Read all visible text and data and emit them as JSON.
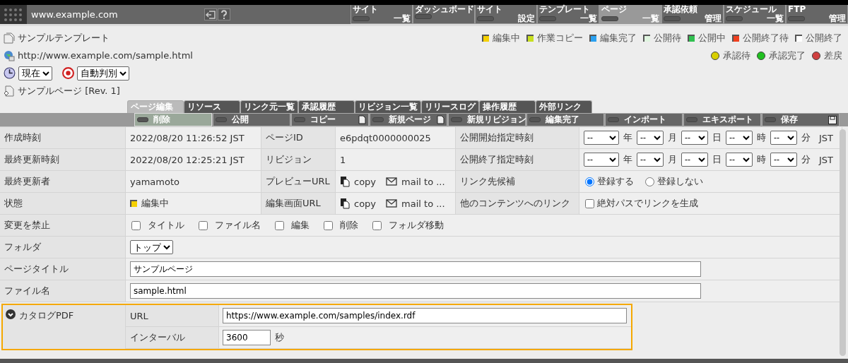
{
  "header": {
    "site": "www.example.com",
    "nav": [
      {
        "top": "サイト",
        "bottom": "一覧",
        "selected": false
      },
      {
        "top": "ダッシュボード",
        "selected": false
      },
      {
        "top": "サイト",
        "bottom": "設定",
        "selected": false
      },
      {
        "top": "テンプレート",
        "bottom": "一覧",
        "selected": false
      },
      {
        "top": "ページ",
        "bottom": "一覧",
        "selected": true
      },
      {
        "top": "承認依頼",
        "bottom": "管理",
        "selected": false
      },
      {
        "top": "スケジュール",
        "bottom": "一覧",
        "selected": false
      },
      {
        "top": "FTP",
        "bottom": "管理",
        "selected": false
      }
    ]
  },
  "info": {
    "template": "サンプルテンプレート",
    "url": "http://www.example.com/sample.html",
    "time": "現在",
    "mode": "自動判別",
    "page": "サンプルページ [Rev. 1]"
  },
  "status_legend": [
    {
      "label": "編集中",
      "color": "#f5d000"
    },
    {
      "label": "作業コピー",
      "color": "#c8e020"
    },
    {
      "label": "編集完了",
      "color": "#2aa0f0"
    },
    {
      "label": "公開待",
      "color": "#e0f5e0"
    },
    {
      "label": "公開中",
      "color": "#30c050"
    },
    {
      "label": "公開終了待",
      "color": "#f04020"
    },
    {
      "label": "公開終了",
      "color": "#ffffff"
    }
  ],
  "approval_legend": [
    {
      "label": "承認待",
      "color": "#d8d000"
    },
    {
      "label": "承認完了",
      "color": "#20c020"
    },
    {
      "label": "差戻",
      "color": "#d04040"
    }
  ],
  "tabs": [
    {
      "label": "ページ編集",
      "selected": true
    },
    {
      "label": "リソース",
      "selected": false
    },
    {
      "label": "リンク元一覧",
      "selected": false
    },
    {
      "label": "承認履歴",
      "selected": false
    },
    {
      "label": "リビジョン一覧",
      "selected": false
    },
    {
      "label": "リリースログ",
      "selected": false
    },
    {
      "label": "操作履歴",
      "selected": false
    },
    {
      "label": "外部リンク",
      "selected": false
    }
  ],
  "actions": [
    {
      "label": "削除",
      "selected": true,
      "kind": "plain"
    },
    {
      "label": "公開",
      "selected": false,
      "kind": "plain"
    },
    {
      "label": "コピー",
      "selected": false,
      "kind": "document"
    },
    {
      "label": "新規ページ",
      "selected": false,
      "kind": "document"
    },
    {
      "label": "新規リビジョン",
      "selected": false,
      "kind": "plain"
    },
    {
      "label": "編集完了",
      "selected": false,
      "kind": "plain"
    },
    {
      "label": "インポート",
      "selected": false,
      "kind": "plain"
    },
    {
      "label": "エキスポート",
      "selected": false,
      "kind": "plain"
    },
    {
      "label": "保存",
      "selected": false,
      "kind": "save"
    }
  ],
  "rows": [
    {
      "cells": [
        {
          "kind": "label",
          "text": "作成時刻"
        },
        {
          "kind": "text",
          "text": "2022/08/20 11:26:52 JST"
        },
        {
          "kind": "label",
          "text": "ページID"
        },
        {
          "kind": "text",
          "text": "e6pdqt0000000025"
        },
        {
          "kind": "label",
          "text": "公開開始指定時刻"
        },
        {
          "kind": "datetime",
          "parts": [
            {
              "value": "--",
              "unit": "年"
            },
            {
              "value": "--",
              "unit": "月"
            },
            {
              "value": "--",
              "unit": "日"
            },
            {
              "value": "--",
              "unit": "時"
            },
            {
              "value": "--",
              "unit": "分"
            }
          ],
          "zone": "JST"
        }
      ]
    },
    {
      "cells": [
        {
          "kind": "label",
          "text": "最終更新時刻"
        },
        {
          "kind": "text",
          "text": "2022/08/20 12:25:21 JST"
        },
        {
          "kind": "label",
          "text": "リビジョン"
        },
        {
          "kind": "text",
          "text": "1"
        },
        {
          "kind": "label",
          "text": "公開終了指定時刻"
        },
        {
          "kind": "datetime",
          "parts": [
            {
              "value": "--",
              "unit": "年"
            },
            {
              "value": "--",
              "unit": "月"
            },
            {
              "value": "--",
              "unit": "日"
            },
            {
              "value": "--",
              "unit": "時"
            },
            {
              "value": "--",
              "unit": "分"
            }
          ],
          "zone": "JST"
        }
      ]
    },
    {
      "cells": [
        {
          "kind": "label",
          "text": "最終更新者"
        },
        {
          "kind": "text",
          "text": "yamamoto"
        },
        {
          "kind": "label",
          "text": "プレビューURL"
        },
        {
          "kind": "share",
          "copy": "copy",
          "mail": "mail to ..."
        },
        {
          "kind": "label",
          "text": "リンク先候補"
        },
        {
          "kind": "radios",
          "options": [
            {
              "label": "登録する",
              "selected": true
            },
            {
              "label": "登録しない",
              "selected": false
            }
          ]
        }
      ]
    },
    {
      "cells": [
        {
          "kind": "label",
          "text": "状態"
        },
        {
          "kind": "status",
          "text": "編集中",
          "color": "#f5d000"
        },
        {
          "kind": "label",
          "text": "編集画面URL"
        },
        {
          "kind": "share",
          "copy": "copy",
          "mail": "mail to ..."
        },
        {
          "kind": "label",
          "text": "他のコンテンツへのリンク"
        },
        {
          "kind": "checks",
          "options": [
            {
              "label": "絶対パスでリンクを生成",
              "checked": false
            }
          ]
        }
      ]
    },
    {
      "cells": [
        {
          "kind": "label",
          "text": "変更を禁止"
        },
        {
          "kind": "checks",
          "options": [
            {
              "label": "タイトル",
              "checked": false
            },
            {
              "label": "ファイル名",
              "checked": false
            },
            {
              "label": "編集",
              "checked": false
            },
            {
              "label": "削除",
              "checked": false
            },
            {
              "label": "フォルダ移動",
              "checked": false
            }
          ]
        }
      ]
    },
    {
      "cells": [
        {
          "kind": "label",
          "text": "フォルダ"
        },
        {
          "kind": "select",
          "value": "トップ"
        }
      ]
    },
    {
      "cells": [
        {
          "kind": "label",
          "text": "ページタイトル"
        },
        {
          "kind": "input",
          "value": "サンプルページ"
        }
      ]
    },
    {
      "cells": [
        {
          "kind": "label",
          "text": "ファイル名"
        },
        {
          "kind": "input",
          "value": "sample.html"
        }
      ]
    }
  ],
  "group": {
    "label": "カタログPDF",
    "expanded": true,
    "fields": [
      {
        "label": "URL",
        "value": "https://www.example.com/samples/index.rdf"
      },
      {
        "label": "インターバル",
        "value": "3600",
        "unit": "秒"
      }
    ]
  }
}
